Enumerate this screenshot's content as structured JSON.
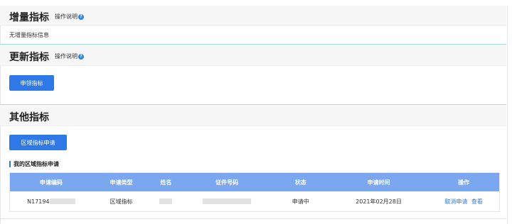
{
  "sections": {
    "incremental": {
      "title": "增量指标",
      "help_label": "操作说明",
      "empty_text": "无增量指标信息"
    },
    "update": {
      "title": "更新指标",
      "help_label": "操作说明",
      "apply_button": "申领指标"
    },
    "other": {
      "title": "其他指标",
      "apply_button": "区域指标申请",
      "subtitle": "我的区域指标申请"
    }
  },
  "table": {
    "columns": [
      "申请编码",
      "申请类型",
      "姓名",
      "证件号码",
      "状态",
      "申请时间",
      "操作"
    ],
    "rows": [
      {
        "code": "N17194",
        "type": "区域指标",
        "name": "",
        "id_number": "",
        "status": "申请中",
        "time": "2021年02月28日",
        "action_cancel": "取消申请",
        "action_view": "查看"
      }
    ]
  },
  "colors": {
    "accent": "#2f78e8",
    "table_header": "#7aa7f0",
    "help_icon": "#2f86e3"
  },
  "icons": {
    "help": "question-circle-icon"
  }
}
